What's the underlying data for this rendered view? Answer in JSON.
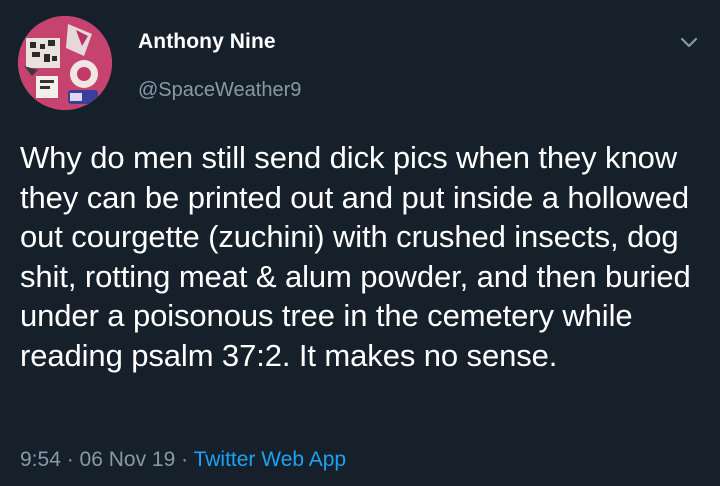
{
  "tweet": {
    "author": {
      "name": "Anthony Nine",
      "handle": "@SpaceWeather9"
    },
    "text": "Why do men still send dick pics when they know they can be printed out and put inside a hollowed out courgette (zuchini) with crushed insects, dog shit, rotting meat & alum powder, and then buried under a poisonous tree in the cemetery while reading psalm 37:2. It makes no sense.",
    "meta": {
      "time": "9:54",
      "separator": " · ",
      "date": "06 Nov 19",
      "source": "Twitter Web App"
    }
  },
  "colors": {
    "background": "#15202b",
    "primary_text": "#ffffff",
    "secondary_text": "#8899a6",
    "link": "#1da1f2"
  },
  "icons": {
    "menu": "chevron-down-icon"
  }
}
